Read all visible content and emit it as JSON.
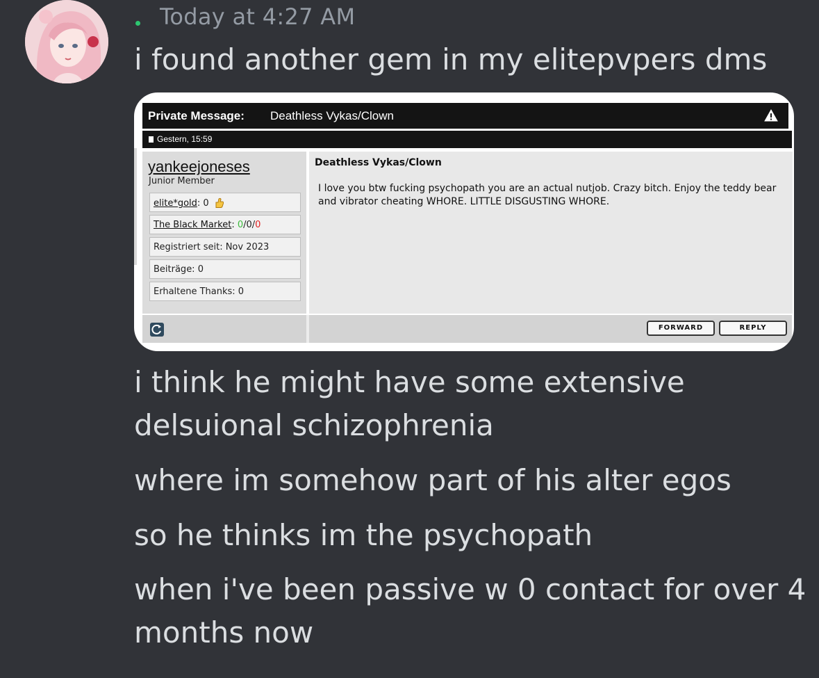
{
  "message": {
    "timestamp": "Today at 4:27 AM",
    "lines": [
      "i found another gem in my elitepvpers dms",
      "i think he might have some extensive",
      "delsuional schizophrenia",
      "where im somehow part of his alter egos",
      "so he thinks im the psychopath",
      "when i've been passive w 0 contact for over 4",
      "months now"
    ]
  },
  "pm": {
    "header_label": "Private Message:",
    "subject": "Deathless Vykas/Clown",
    "date": "Gestern, 15:59",
    "username": "yankeejoneses",
    "user_title": "Junior Member",
    "elite_gold_label": "elite*gold",
    "elite_gold_value": "0",
    "black_market_label": "The Black Market",
    "bm_positive": "0",
    "bm_neutral": "0",
    "bm_negative": "0",
    "registered": "Registriert seit: Nov 2023",
    "posts": "Beiträge: 0",
    "thanks": "Erhaltene Thanks: 0",
    "title": "Deathless Vykas/Clown",
    "body": "I love you btw fucking psychopath you are an actual nutjob. Crazy bitch. Enjoy the teddy bear and vibrator cheating WHORE. LITTLE DISGUSTING WHORE.",
    "forward_label": "FORWARD",
    "reply_label": "REPLY"
  },
  "colors": {
    "background": "#313338",
    "text": "#dbdee1",
    "timestamp": "#949ba4",
    "status": "#2dc770"
  }
}
